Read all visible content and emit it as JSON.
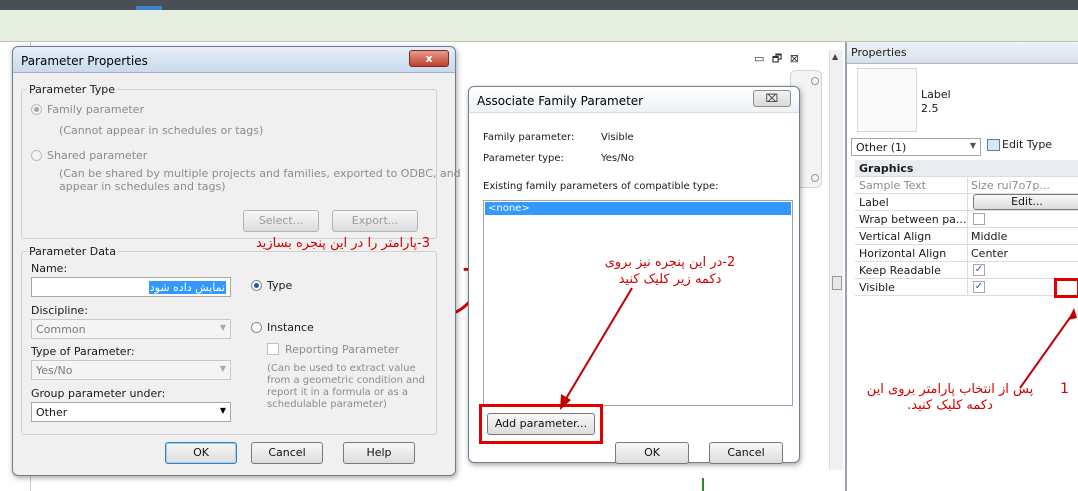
{
  "parameter_properties": {
    "title": "Parameter Properties",
    "close_label": "x",
    "parameter_type": {
      "group_label": "Parameter Type",
      "family_parameter": "Family parameter",
      "family_note": "(Cannot appear in schedules or tags)",
      "shared_parameter": "Shared parameter",
      "shared_note_line1": "(Can be shared by multiple projects and families, exported to ODBC, and",
      "shared_note_line2": "appear in schedules and tags)",
      "select_button": "Select...",
      "export_button": "Export..."
    },
    "parameter_data": {
      "group_label": "Parameter Data",
      "name_label": "Name:",
      "name_value": "نمایش داده شود",
      "discipline_label": "Discipline:",
      "discipline_value": "Common",
      "type_label": "Type of Parameter:",
      "type_value": "Yes/No",
      "group_under_label": "Group parameter under:",
      "group_under_value": "Other",
      "type_radio": "Type",
      "instance_radio": "Instance",
      "reporting_parameter": "Reporting Parameter",
      "reporting_note_line1": "(Can be used to extract value",
      "reporting_note_line2": "from a geometric condition and",
      "reporting_note_line3": "report it in a formula or as a",
      "reporting_note_line4": "schedulable parameter)"
    },
    "ok_button": "OK",
    "cancel_button": "Cancel",
    "help_button": "Help"
  },
  "associate_dialog": {
    "title": "Associate Family Parameter",
    "close_label": "⌧",
    "family_parameter_label": "Family parameter:",
    "family_parameter_value": "Visible",
    "parameter_type_label": "Parameter type:",
    "parameter_type_value": "Yes/No",
    "existing_label": "Existing family parameters of compatible type:",
    "list_items": [
      "<none>"
    ],
    "add_parameter_button": "Add parameter...",
    "ok_button": "OK",
    "cancel_button": "Cancel"
  },
  "annotations": {
    "step3": "3-پارامتر را در این پنجره بسازید",
    "step2_line1": "2-در این پنجره نیز بروی",
    "step2_line2": "دکمه زیر کلیک کنید",
    "step1_num": "1",
    "step1_line1": "پس از انتخاب پارامتر بروی این",
    "step1_line2": "دکمه کلیک کنید.",
    "color": "#d40000"
  },
  "view_controls": {
    "minimize": "▭",
    "restore": "🗗",
    "close": "⊠"
  },
  "properties_panel": {
    "title": "Properties",
    "label_text": "Label",
    "label_size": "2.5",
    "filter_value": "Other (1)",
    "edit_type_button": "Edit Type",
    "section": "Graphics",
    "rows": [
      {
        "key": "Sample Text",
        "value": "Size rui7o7p..."
      },
      {
        "key": "Label",
        "value": "Edit..."
      },
      {
        "key": "Wrap between pa...",
        "value": ""
      },
      {
        "key": "Vertical Align",
        "value": "Middle"
      },
      {
        "key": "Horizontal Align",
        "value": "Center"
      },
      {
        "key": "Keep Readable",
        "value": "✓"
      },
      {
        "key": "Visible",
        "value": "✓"
      }
    ]
  }
}
